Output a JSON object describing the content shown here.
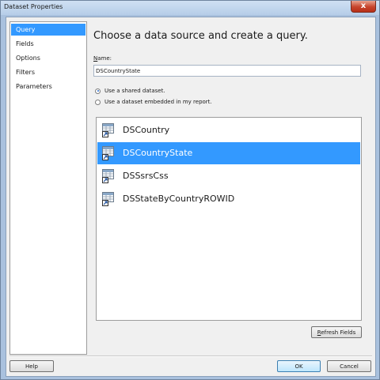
{
  "window": {
    "title": "Dataset Properties",
    "close_label": "x"
  },
  "nav": {
    "items": [
      "Query",
      "Fields",
      "Options",
      "Filters",
      "Parameters"
    ],
    "active": "Query"
  },
  "main": {
    "heading": "Choose a data source and create a query.",
    "name_label_underline": "N",
    "name_label_rest": "ame:",
    "name_value": "DSCountryState",
    "radio_shared": "Use a shared dataset.",
    "radio_embedded": "Use a dataset embedded in my report.",
    "datasets": [
      "DSCountry",
      "DSCountryState",
      "DSSsrsCss",
      "DSStateByCountryROWID"
    ],
    "selected_dataset": "DSCountryState",
    "refresh_underline": "R",
    "refresh_rest": "efresh Fields"
  },
  "footer": {
    "help_label": "Help",
    "ok_label": "OK",
    "cancel_label": "Cancel"
  },
  "colors": {
    "selection": "#3399ff",
    "title_bg": "#b6cde8",
    "close_btn": "#c7442c"
  },
  "icons": {
    "dataset_item": "shared-dataset-icon"
  }
}
